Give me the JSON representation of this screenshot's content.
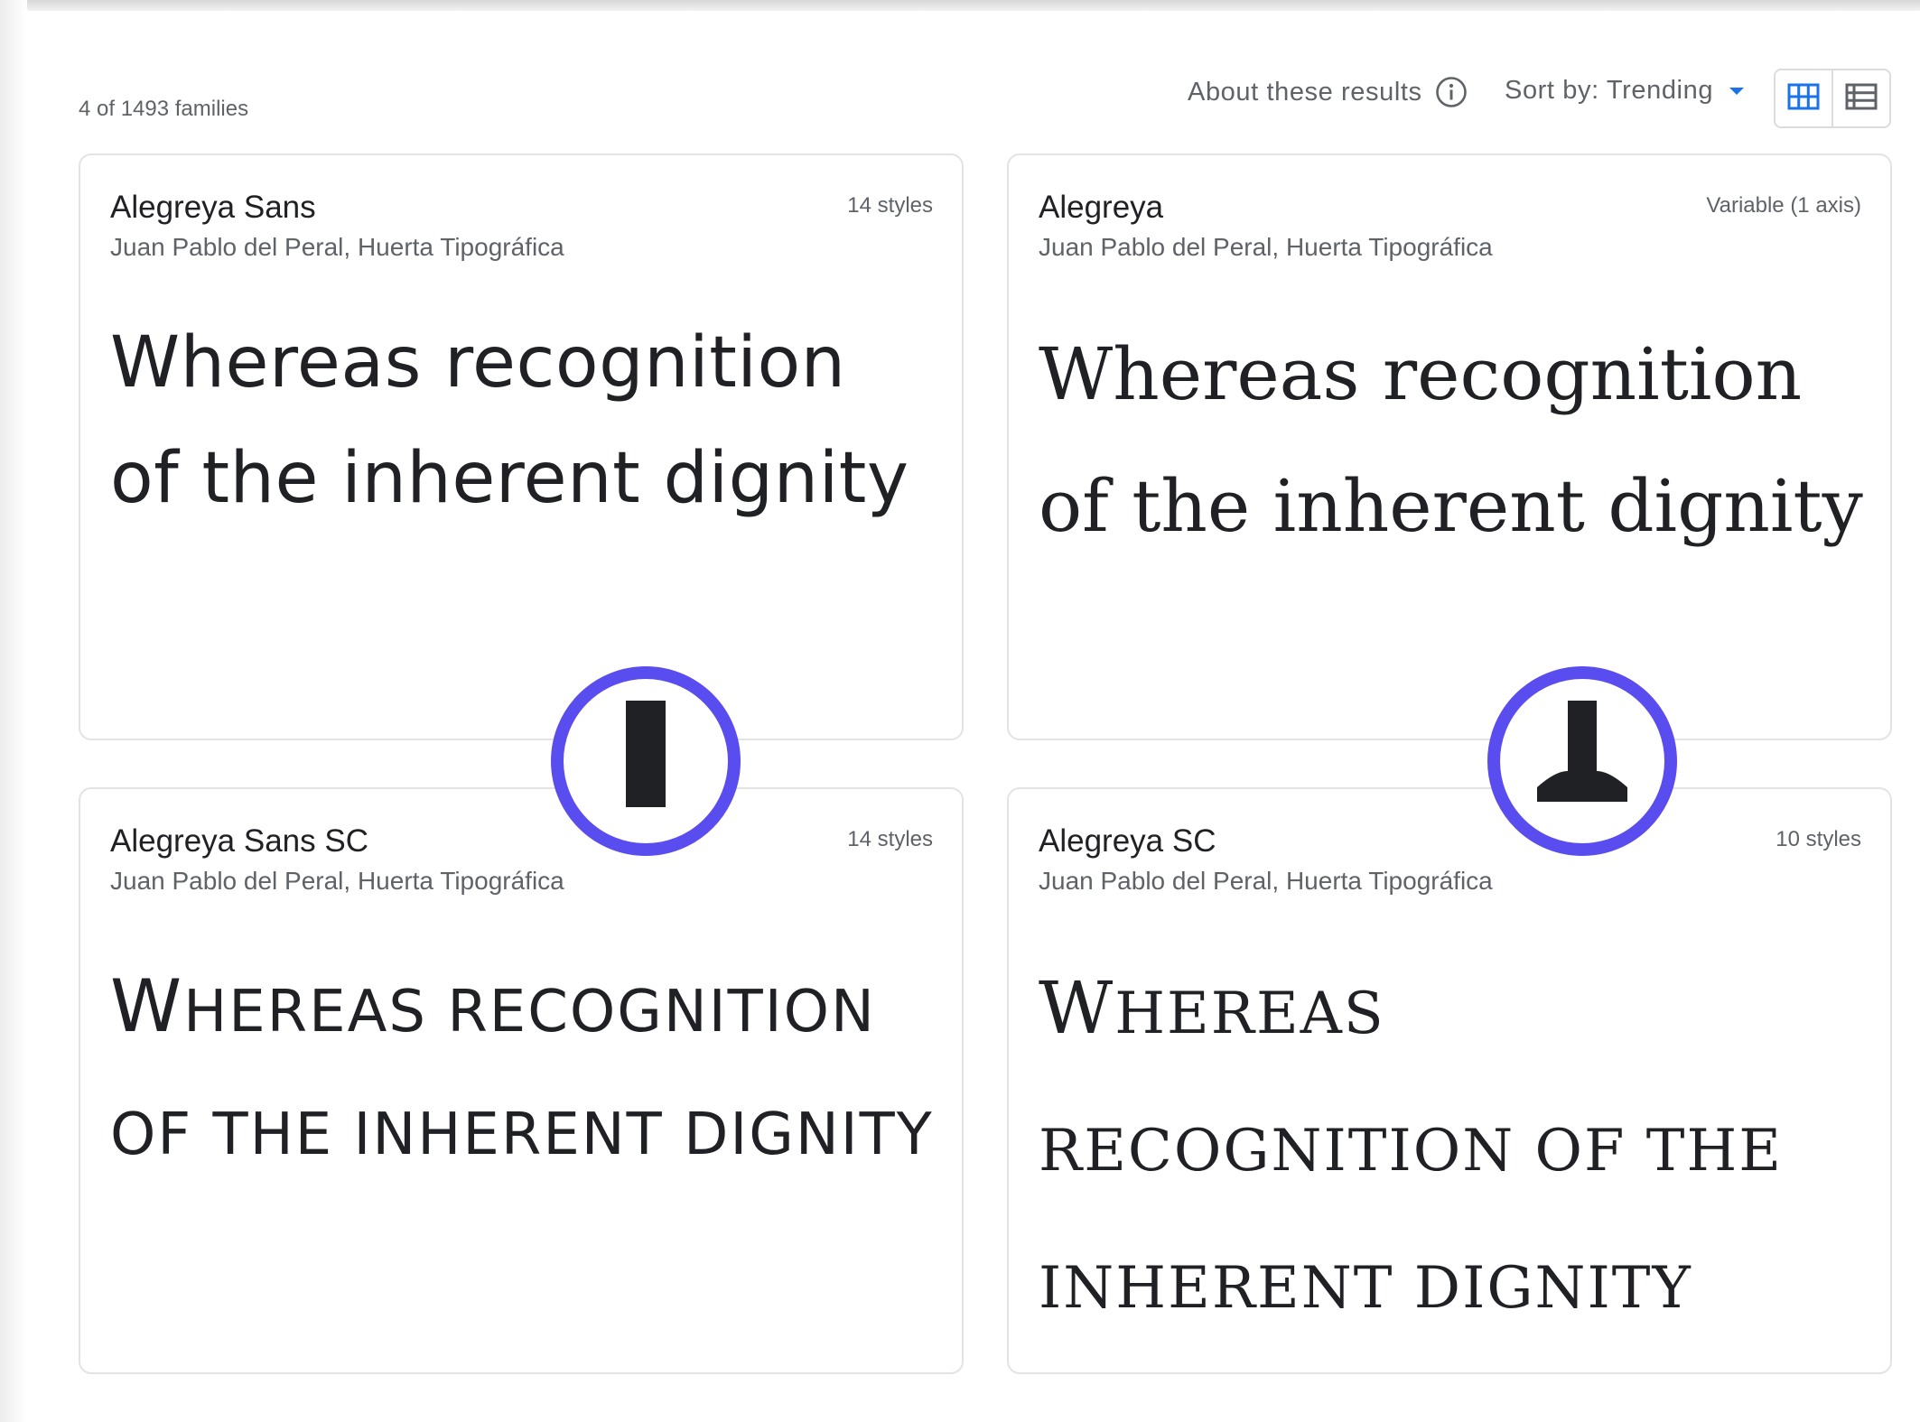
{
  "results": {
    "count_text": "4 of 1493 families"
  },
  "toolbar": {
    "about_label": "About these results",
    "sort_label": "Sort by: Trending",
    "grid_view_icon": "grid-view-icon",
    "list_view_icon": "list-view-icon",
    "accent_color": "#1a73e8"
  },
  "cards": [
    {
      "name": "Alegreya Sans",
      "authors": "Juan Pablo del Peral, Huerta Tipográfica",
      "styles": "14 styles",
      "sample": "Whereas recognition of the inherent dignity"
    },
    {
      "name": "Alegreya",
      "authors": "Juan Pablo del Peral, Huerta Tipográfica",
      "styles": "Variable (1 axis)",
      "sample": "Whereas recognition of the inherent dignity"
    },
    {
      "name": "Alegreya Sans SC",
      "authors": "Juan Pablo del Peral, Huerta Tipográfica",
      "styles": "14 styles",
      "sample": "Whereas recognition of the inherent dignity"
    },
    {
      "name": "Alegreya SC",
      "authors": "Juan Pablo del Peral, Huerta Tipográfica",
      "styles": "10 styles",
      "sample": "Whereas recognition of the inherent dignity"
    }
  ],
  "highlights": {
    "ring_color": "#5a4df0",
    "left_glyph": "vertical-stem-icon",
    "right_glyph": "t-stem-icon"
  }
}
